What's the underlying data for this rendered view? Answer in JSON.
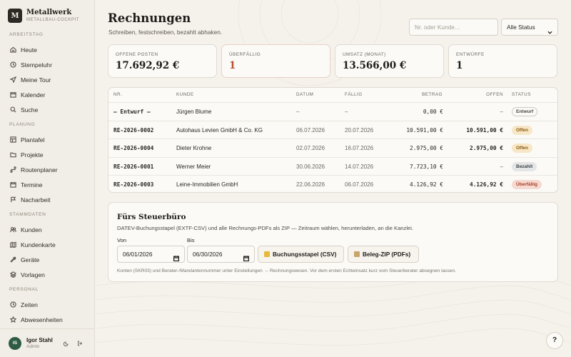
{
  "brand": {
    "logo_letter": "M",
    "name": "Metallwerk",
    "subtitle": "METALLBAU-COCKPIT"
  },
  "sidebar": {
    "sections": [
      {
        "title": "ARBEITSTAG",
        "items": [
          {
            "label": "Heute",
            "icon": "home-icon"
          },
          {
            "label": "Stempeluhr",
            "icon": "clock-icon"
          },
          {
            "label": "Meine Tour",
            "icon": "navigation-icon"
          },
          {
            "label": "Kalender",
            "icon": "calendar-icon"
          },
          {
            "label": "Suche",
            "icon": "search-icon"
          }
        ]
      },
      {
        "title": "PLANUNG",
        "items": [
          {
            "label": "Plantafel",
            "icon": "board-icon"
          },
          {
            "label": "Projekte",
            "icon": "folder-icon"
          },
          {
            "label": "Routenplaner",
            "icon": "route-icon"
          },
          {
            "label": "Termine",
            "icon": "calendar-clock-icon"
          },
          {
            "label": "Nacharbeit",
            "icon": "flag-icon"
          }
        ]
      },
      {
        "title": "STAMMDATEN",
        "items": [
          {
            "label": "Kunden",
            "icon": "users-icon"
          },
          {
            "label": "Kundenkarte",
            "icon": "map-icon"
          },
          {
            "label": "Geräte",
            "icon": "wrench-icon"
          },
          {
            "label": "Vorlagen",
            "icon": "layers-icon"
          }
        ]
      },
      {
        "title": "PERSONAL",
        "items": [
          {
            "label": "Zeiten",
            "icon": "clock-icon"
          },
          {
            "label": "Abwesenheiten",
            "icon": "star-icon"
          }
        ]
      }
    ]
  },
  "user": {
    "initials": "IS",
    "name": "Igor Stahl",
    "role": "Admin"
  },
  "page": {
    "title": "Rechnungen",
    "subtitle": "Schreiben, festschreiben, bezahlt abhaken."
  },
  "filters": {
    "search_placeholder": "Nr. oder Kunde…",
    "status_value": "Alle Status"
  },
  "kpis": [
    {
      "label": "OFFENE POSTEN",
      "value": "17.692,92 €"
    },
    {
      "label": "ÜBERFÄLLIG",
      "value": "1"
    },
    {
      "label": "UMSATZ (MONAT)",
      "value": "13.566,00 €"
    },
    {
      "label": "ENTWÜRFE",
      "value": "1"
    }
  ],
  "table": {
    "headers": [
      "NR.",
      "KUNDE",
      "DATUM",
      "FÄLLIG",
      "BETRAG",
      "OFFEN",
      "STATUS"
    ],
    "rows": [
      {
        "nr": "— Entwurf —",
        "kunde": "Jürgen Blume",
        "datum": "–",
        "faellig": "–",
        "betrag": "0,00 €",
        "offen": "–",
        "status": "Entwurf"
      },
      {
        "nr": "RE-2026-0002",
        "kunde": "Autohaus Levien GmbH & Co. KG",
        "datum": "06.07.2026",
        "faellig": "20.07.2026",
        "betrag": "10.591,00 €",
        "offen": "10.591,00 €",
        "status": "Offen"
      },
      {
        "nr": "RE-2026-0004",
        "kunde": "Dieter Krohne",
        "datum": "02.07.2026",
        "faellig": "16.07.2026",
        "betrag": "2.975,00 €",
        "offen": "2.975,00 €",
        "status": "Offen"
      },
      {
        "nr": "RE-2026-0001",
        "kunde": "Werner Meier",
        "datum": "30.06.2026",
        "faellig": "14.07.2026",
        "betrag": "7.723,10 €",
        "offen": "–",
        "status": "Bezahlt"
      },
      {
        "nr": "RE-2026-0003",
        "kunde": "Leine-Immobilien GmbH",
        "datum": "22.06.2026",
        "faellig": "06.07.2026",
        "betrag": "4.126,92 €",
        "offen": "4.126,92 €",
        "status": "Überfällig"
      }
    ]
  },
  "status_colors": {
    "Entwurf": {
      "bg": "#fbfaf7",
      "fg": "#4e4841",
      "border": "#cfc9bf"
    },
    "Offen": {
      "bg": "#f7e7c6",
      "fg": "#8a5a12",
      "border": "#f7e7c6"
    },
    "Bezahlt": {
      "bg": "#e3e5e6",
      "fg": "#3e4448",
      "border": "#e3e5e6"
    },
    "Überfällig": {
      "bg": "#f6d9d0",
      "fg": "#a8432a",
      "border": "#f6d9d0"
    }
  },
  "export": {
    "title": "Fürs Steuerbüro",
    "description": "DATEV-Buchungsstapel (EXTF-CSV) und alle Rechnungs-PDFs als ZIP — Zeitraum wählen, herunterladen, an die Kanzlei.",
    "from_label": "Von",
    "from_value": "06/01/2026",
    "to_label": "Bis",
    "to_value": "06/30/2026",
    "csv_button": "Buchungsstapel (CSV)",
    "zip_button": "Beleg-ZIP (PDFs)",
    "note": "Konten (SKR03) und Berater-/Mandantennummer unter Einstellungen → Rechnungswesen. Vor dem ersten Echteinsatz kurz vom Steuerberater absegnen lassen."
  },
  "help": {
    "label": "?"
  },
  "colors": {
    "accent_green": "#2f5a44",
    "overdue_red": "#b5502f"
  }
}
